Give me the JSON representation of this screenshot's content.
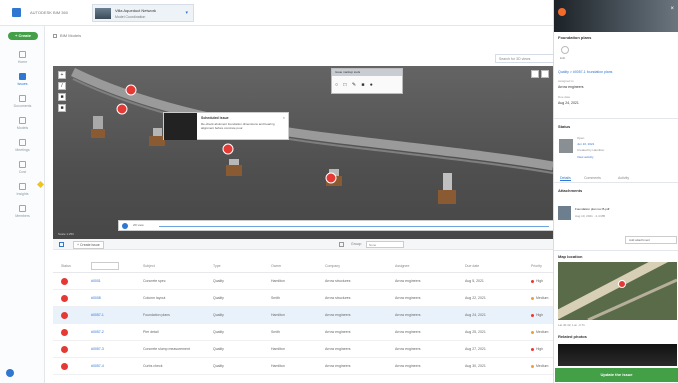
{
  "app": {
    "title": "AUTODESK BIM 360"
  },
  "project": {
    "name": "Villa Aqueduct Network",
    "subtitle": "Model Coordination"
  },
  "sidebar": {
    "create_label": "+ Create",
    "items": [
      {
        "label": "Home"
      },
      {
        "label": "Issues"
      },
      {
        "label": "Documents"
      },
      {
        "label": "Models"
      },
      {
        "label": "Meetings"
      },
      {
        "label": "Cost"
      },
      {
        "label": "Insights"
      },
      {
        "label": "Members"
      }
    ]
  },
  "breadcrumb": {
    "label": "BIM Models"
  },
  "viewer": {
    "view_input": "Search for 3D views",
    "toolbar_title": "Issue markup tools",
    "popup": {
      "title": "Scheduled issue",
      "body": "Re-check abutment foundation dimensions and bearing alignment before concrete pour."
    },
    "play_label": "2D view",
    "scale_label": "Scale 1:250"
  },
  "table_toolbar": {
    "create_label": "+ Create issue",
    "group_label": "Group:",
    "group_value": "None"
  },
  "table": {
    "headers": [
      "Status",
      "ID",
      "Subject",
      "Type",
      "Owner",
      "Company",
      "Assignee",
      "Due date",
      "Priority"
    ],
    "rows": [
      {
        "id": "#0001",
        "subject": "Concrete spec",
        "type": "Quality",
        "owner": "Hamilton",
        "company": "Arrow structures",
        "assignee": "Arrow engineers",
        "due": "Aug 5, 2021",
        "priority": "High",
        "selected": false
      },
      {
        "id": "#0008",
        "subject": "Column layout",
        "type": "Quality",
        "owner": "Smith",
        "company": "Arrow structures",
        "assignee": "Arrow engineers",
        "due": "Aug 22, 2021",
        "priority": "Medium",
        "selected": false
      },
      {
        "id": "#0057-1",
        "subject": "Foundation plans",
        "type": "Quality",
        "owner": "Hamilton",
        "company": "Arrow engineers",
        "assignee": "Arrow engineers",
        "due": "Aug 24, 2021",
        "priority": "High",
        "selected": true
      },
      {
        "id": "#0057-2",
        "subject": "Pier detail",
        "type": "Quality",
        "owner": "Smith",
        "company": "Arrow engineers",
        "assignee": "Arrow engineers",
        "due": "Aug 25, 2021",
        "priority": "Medium",
        "selected": false
      },
      {
        "id": "#0057-3",
        "subject": "Concrete slump measurement",
        "type": "Quality",
        "owner": "Hamilton",
        "company": "Arrow engineers",
        "assignee": "Arrow engineers",
        "due": "Aug 27, 2021",
        "priority": "High",
        "selected": false
      },
      {
        "id": "#0057-4",
        "subject": "Curbs check",
        "type": "Quality",
        "owner": "Hamilton",
        "company": "Arrow engineers",
        "assignee": "Arrow engineers",
        "due": "Aug 30, 2021",
        "priority": "Medium",
        "selected": false
      }
    ]
  },
  "panel": {
    "title": "Foundation plans",
    "edit_label": "Edit",
    "category": "Quality > #0057-1 foundation plans",
    "assigned_label": "Assigned to",
    "assigned_value": "Arrow engineers",
    "due_label": "Due date",
    "due_value": "Aug 24, 2021",
    "section_status": "Status",
    "status_badge": "Open",
    "status_date": "Jun 10, 2021",
    "status_note": "Created by Hamilton",
    "status_link": "View activity",
    "tabs": [
      "Details",
      "Comments",
      "Activity"
    ],
    "attachments_title": "Attachments",
    "attachment_name": "Foundation plan rev B.pdf",
    "attachment_meta": "Aug 10, 2021 · 2.4 MB",
    "add_label": "Add attachment",
    "map_title": "Map location",
    "map_caption": "Lat 40.42, Lon -3.71",
    "photos_title": "Related photos",
    "cta_label": "Update the issue"
  },
  "colors": {
    "brand": "#2f77d0",
    "create": "#43a047",
    "issue": "#e53935",
    "high": "#e53935",
    "medium": "#f0a030"
  },
  "icons": [
    "bim360-logo",
    "pencil-icon",
    "issue-pin-icon",
    "play-icon",
    "close-icon"
  ]
}
